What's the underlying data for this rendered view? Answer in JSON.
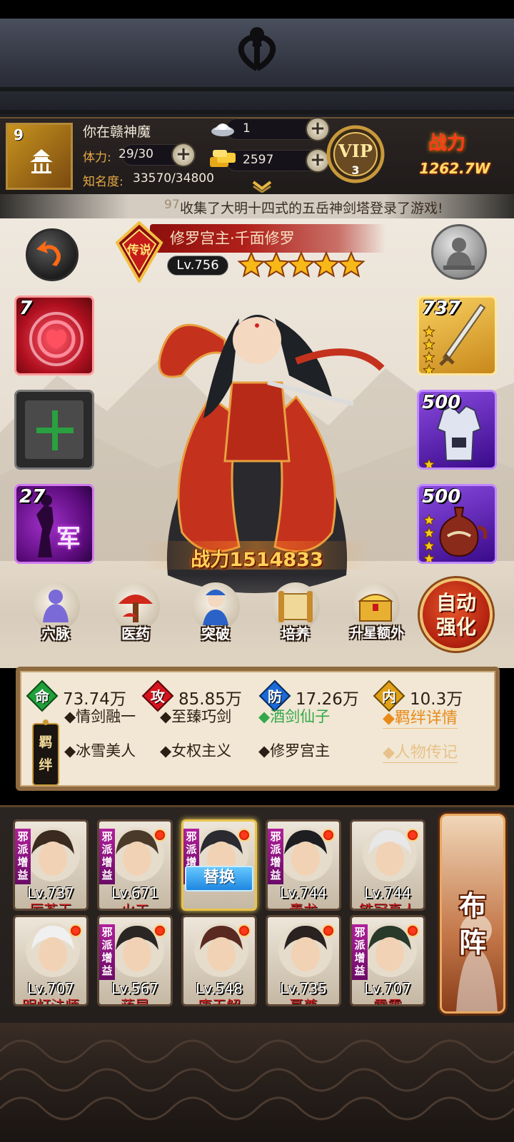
{
  "player": {
    "level": "9",
    "name": "你在赣神魔",
    "stamina_label": "体力:",
    "stamina_value": "29/30",
    "fame_label": "知名度:",
    "fame_value": "33570/34800"
  },
  "resources": {
    "silver": "1",
    "gold": "2597"
  },
  "vip": {
    "label": "VIP",
    "level": "3"
  },
  "power_header": {
    "title": "战力",
    "value": "1262.7W"
  },
  "marquee": {
    "prefix": "97",
    "text": "收集了大明十四式的五岳神剑塔登录了游戏!"
  },
  "hero": {
    "rank_badge": "传说",
    "name": "修罗宫主·千面修罗",
    "level": "Lv.756",
    "stars": 5,
    "combat_label": "战力",
    "combat_value": "1514833"
  },
  "slots": {
    "top_left": {
      "count": "7"
    },
    "army": {
      "count": "27",
      "label": "军"
    },
    "weapon": {
      "count": "737",
      "stars": 4
    },
    "armor": {
      "count": "500",
      "stars": 1
    },
    "treasure": {
      "count": "500",
      "stars": 4
    }
  },
  "functions": [
    {
      "id": "meridian",
      "label": "穴脉"
    },
    {
      "id": "medicine",
      "label": "医药"
    },
    {
      "id": "breakthrough",
      "label": "突破"
    },
    {
      "id": "cultivate",
      "label": "培养"
    },
    {
      "id": "star_up",
      "label": "升星额外"
    }
  ],
  "auto_strengthen": {
    "line1": "自动",
    "line2": "强化"
  },
  "stats": [
    {
      "key": "life",
      "label": "命",
      "value": "73.74万",
      "color": "#1fa03a"
    },
    {
      "key": "attack",
      "label": "攻",
      "value": "85.85万",
      "color": "#d4141e"
    },
    {
      "key": "defense",
      "label": "防",
      "value": "17.26万",
      "color": "#1a6ad8"
    },
    {
      "key": "inner",
      "label": "内",
      "value": "10.3万",
      "color": "#e0a018"
    }
  ],
  "bonds": {
    "tag": "羁绊",
    "row1": [
      "◆情剑融一",
      "◆至臻巧剑",
      "◆酒剑仙子"
    ],
    "row2": [
      "◆冰雪美人",
      "◆女权主义",
      "◆修罗宫主"
    ],
    "details_link": "◆羁绊详情",
    "biography_link": "◆人物传记"
  },
  "roster": {
    "faction_tag": "邪派增益",
    "replace_label": "替换",
    "formation_label": "布阵",
    "heroes": [
      {
        "level": "Lv.737",
        "name": "厉苍天",
        "faction": true,
        "dot": false
      },
      {
        "level": "Lv.671",
        "name": "火工",
        "faction": true,
        "dot": true
      },
      {
        "level": "",
        "name": "",
        "faction": true,
        "dot": true,
        "selected": true
      },
      {
        "level": "Lv.744",
        "name": "青龙",
        "faction": true,
        "dot": true
      },
      {
        "level": "Lv.744",
        "name": "铁冠真人",
        "faction": false,
        "dot": true
      },
      {
        "level": "Lv.707",
        "name": "明灯法师",
        "faction": false,
        "dot": true
      },
      {
        "level": "Lv.567",
        "name": "蒋昆",
        "faction": true,
        "dot": true
      },
      {
        "level": "Lv.548",
        "name": "唐无解",
        "faction": false,
        "dot": true
      },
      {
        "level": "Lv.735",
        "name": "聂尊",
        "faction": false,
        "dot": true
      },
      {
        "level": "Lv.707",
        "name": "雷震",
        "faction": true,
        "dot": true
      }
    ]
  }
}
